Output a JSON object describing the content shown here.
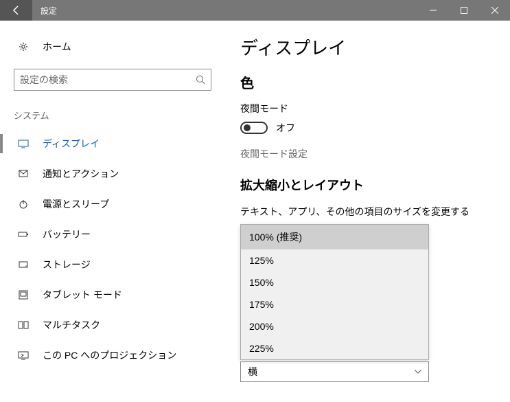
{
  "titlebar": {
    "title": "設定"
  },
  "sidebar": {
    "home": "ホーム",
    "search_placeholder": "設定の検索",
    "category": "システム",
    "items": [
      {
        "label": "ディスプレイ"
      },
      {
        "label": "通知とアクション"
      },
      {
        "label": "電源とスリープ"
      },
      {
        "label": "バッテリー"
      },
      {
        "label": "ストレージ"
      },
      {
        "label": "タブレット モード"
      },
      {
        "label": "マルチタスク"
      },
      {
        "label": "この PC へのプロジェクション"
      }
    ]
  },
  "main": {
    "page_title": "ディスプレイ",
    "color_section": "色",
    "night_mode_label": "夜間モード",
    "night_mode_state": "オフ",
    "night_mode_settings": "夜間モード設定",
    "scale_section": "拡大縮小とレイアウト",
    "scale_label": "テキスト、アプリ、その他の項目のサイズを変更する",
    "scale_options": [
      "100% (推奨)",
      "125%",
      "150%",
      "175%",
      "200%",
      "225%"
    ],
    "orientation_value": "横"
  }
}
